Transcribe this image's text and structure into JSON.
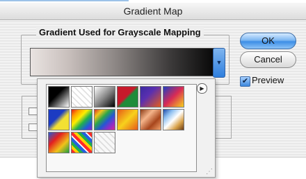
{
  "dialog": {
    "title": "Gradient Map",
    "group_label": "Gradient Used for Grayscale Mapping",
    "ok_label": "OK",
    "cancel_label": "Cancel",
    "preview_label": "Preview",
    "preview_checked": true
  },
  "picker": {
    "swatches": [
      {
        "name": "black-white",
        "fill": "linear-gradient(135deg,#000 0%,#000 40%,#fff 100%)"
      },
      {
        "name": "transparent",
        "fill": "repeating-linear-gradient(45deg,#fff 0 4px,#e2e2e2 4px 6px)"
      },
      {
        "name": "black-white-soft",
        "fill": "linear-gradient(135deg,#fff 0%,#888 50%,#000 100%)"
      },
      {
        "name": "red-green",
        "fill": "linear-gradient(135deg,#c7192b 0%,#c7192b 45%,#1d8c3a 55%,#1d8c3a 100%)"
      },
      {
        "name": "violet-orange",
        "fill": "linear-gradient(135deg,#3b2aa0 0%,#5a2fb0 40%,#e35c1e 100%)"
      },
      {
        "name": "blue-red-yellow",
        "fill": "linear-gradient(135deg,#1f3ec2 0%,#d92b55 50%,#f6d11e 100%)"
      },
      {
        "name": "blue-yellow",
        "fill": "linear-gradient(135deg,#1c3bc2 0%,#1c3bc2 40%,#f3e032 60%,#f3e032 100%)"
      },
      {
        "name": "spectrum",
        "fill": "linear-gradient(135deg,#e31a1c,#ff9f00,#ffee00,#22b14c,#1f60d6,#8a1fd0)"
      },
      {
        "name": "spectrum-2",
        "fill": "linear-gradient(135deg,#d42d2d,#f0c51c,#2ca54a,#2457d4,#8e2dc9,#d42d8c)"
      },
      {
        "name": "orange-yellow-orange",
        "fill": "linear-gradient(135deg,#e65a18,#f7d11c,#e65a18)"
      },
      {
        "name": "copper",
        "fill": "linear-gradient(135deg,#8a3b16,#f4b48a,#a8461c,#f0a06a)"
      },
      {
        "name": "chrome",
        "fill": "linear-gradient(135deg,#1d4aa8,#8fc0f0,#fff,#d9a24a,#6b3c15)"
      },
      {
        "name": "rainbow-stripes",
        "fill": "linear-gradient(135deg,#2459d6,#e32020,#f0c21a,#1e9e3e)"
      },
      {
        "name": "spectrum-transparent",
        "fill": "repeating-linear-gradient(45deg,#ff2a2a 0 4px,#ffd000 4px 8px,#20b04a 8px 12px,#2460e0 12px 16px,#ffffff 16px 18px)"
      },
      {
        "name": "checker-transparent",
        "fill": "repeating-linear-gradient(45deg,#f8f8f8 0 4px,#dddddd 4px 6px)"
      }
    ]
  }
}
